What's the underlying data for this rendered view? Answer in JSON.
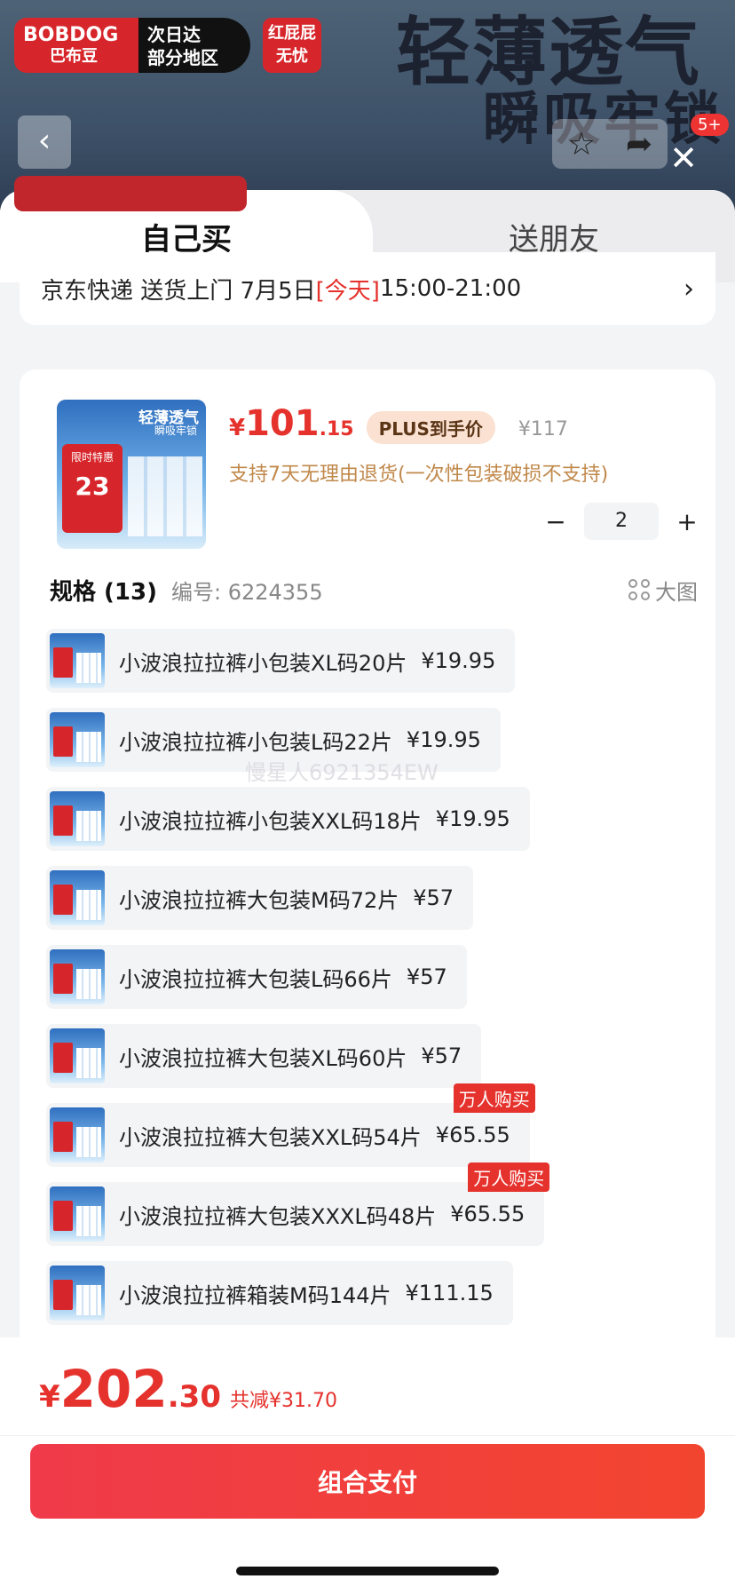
{
  "backdrop": {
    "brand_en": "BOBDOG",
    "brand_cn": "巴布豆",
    "fast_line1": "次日达",
    "fast_line2": "部分地区",
    "red_line1": "红屁屁",
    "red_line2": "无忧",
    "headline1": "轻薄透气",
    "headline2": "瞬吸牢锁",
    "badge": "5+"
  },
  "tabs": {
    "self": "自己买",
    "gift": "送朋友"
  },
  "delivery": {
    "prefix": "京东快递 送货上门 7月5日 ",
    "today": "[今天]",
    "time": " 15:00-21:00"
  },
  "product": {
    "thumb_title": "轻薄透气",
    "thumb_sub": "瞬吸牢锁",
    "thumb_promo": "限时特惠",
    "thumb_num": "23",
    "price_yen": "¥",
    "price_int": "101",
    "price_dec": ".15",
    "plus_label": "PLUS到手价",
    "orig_price": "¥117",
    "return_policy": "支持7天无理由退货(一次性包装破损不支持)",
    "qty_minus": "−",
    "qty": "2",
    "qty_plus": "+"
  },
  "spec": {
    "title": "规格 (13)",
    "code": "编号: 6224355",
    "big_view": "大图"
  },
  "variants": [
    {
      "label": "小波浪拉拉裤小包装XL码20片",
      "price": "¥19.95",
      "tag": ""
    },
    {
      "label": "小波浪拉拉裤小包装L码22片",
      "price": "¥19.95",
      "tag": ""
    },
    {
      "label": "小波浪拉拉裤小包装XXL码18片",
      "price": "¥19.95",
      "tag": ""
    },
    {
      "label": "小波浪拉拉裤大包装M码72片",
      "price": "¥57",
      "tag": ""
    },
    {
      "label": "小波浪拉拉裤大包装L码66片",
      "price": "¥57",
      "tag": ""
    },
    {
      "label": "小波浪拉拉裤大包装XL码60片",
      "price": "¥57",
      "tag": ""
    },
    {
      "label": "小波浪拉拉裤大包装XXL码54片",
      "price": "¥65.55",
      "tag": "万人购买"
    },
    {
      "label": "小波浪拉拉裤大包装XXXL码48片",
      "price": "¥65.55",
      "tag": "万人购买"
    },
    {
      "label": "小波浪拉拉裤箱装M码144片",
      "price": "¥111.15",
      "tag": ""
    }
  ],
  "watermark": "慢星人6921354EW",
  "footer": {
    "yen": "¥",
    "total_int": "202",
    "total_dec": ".30",
    "saving": "共减¥31.70",
    "pay_label": "组合支付"
  }
}
